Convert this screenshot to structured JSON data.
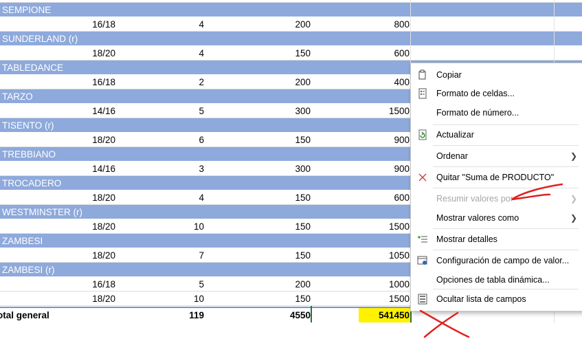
{
  "pivot": {
    "groups": [
      {
        "name": "SEMPIONE",
        "rows": [
          [
            "16/18",
            "4",
            "200",
            "800"
          ]
        ]
      },
      {
        "name": "SUNDERLAND (r)",
        "rows": [
          [
            "18/20",
            "4",
            "150",
            "600"
          ]
        ]
      },
      {
        "name": "TABLEDANCE",
        "rows": [
          [
            "16/18",
            "2",
            "200",
            "400"
          ]
        ]
      },
      {
        "name": "TARZO",
        "rows": [
          [
            "14/16",
            "5",
            "300",
            "1500"
          ]
        ]
      },
      {
        "name": "TISENTO (r)",
        "rows": [
          [
            "18/20",
            "6",
            "150",
            "900"
          ]
        ]
      },
      {
        "name": "TREBBIANO",
        "rows": [
          [
            "14/16",
            "3",
            "300",
            "900"
          ]
        ]
      },
      {
        "name": "TROCADERO",
        "rows": [
          [
            "18/20",
            "4",
            "150",
            "600"
          ]
        ]
      },
      {
        "name": "WESTMINSTER (r)",
        "rows": [
          [
            "18/20",
            "10",
            "150",
            "1500"
          ]
        ]
      },
      {
        "name": "ZAMBESI",
        "rows": [
          [
            "18/20",
            "7",
            "150",
            "1050"
          ]
        ]
      },
      {
        "name": "ZAMBESI (r)",
        "rows": [
          [
            "16/18",
            "5",
            "200",
            "1000"
          ],
          [
            "18/20",
            "10",
            "150",
            "1500"
          ]
        ]
      }
    ],
    "total": {
      "label": "otal general",
      "values": [
        "119",
        "4550",
        "541450"
      ]
    }
  },
  "context_menu": {
    "items": [
      {
        "label": "Copiar",
        "icon": "copy-icon",
        "enabled": true,
        "submenu": false
      },
      {
        "label": "Formato de celdas...",
        "icon": "format-cells-icon",
        "enabled": true,
        "submenu": false
      },
      {
        "label": "Formato de número...",
        "icon": "",
        "enabled": true,
        "submenu": false
      },
      {
        "label": "Actualizar",
        "icon": "refresh-icon",
        "enabled": true,
        "submenu": false
      },
      {
        "label": "Ordenar",
        "icon": "",
        "enabled": true,
        "submenu": true
      },
      {
        "label": "Quitar \"Suma de PRODUCTO\"",
        "icon": "remove-x-icon",
        "enabled": true,
        "submenu": false
      },
      {
        "label": "Resumir valores por",
        "icon": "",
        "enabled": false,
        "submenu": true
      },
      {
        "label": "Mostrar valores como",
        "icon": "",
        "enabled": true,
        "submenu": true
      },
      {
        "label": "Mostrar detalles",
        "icon": "show-details-icon",
        "enabled": true,
        "submenu": false
      },
      {
        "label": "Configuración de campo de valor...",
        "icon": "field-settings-icon",
        "enabled": true,
        "submenu": false
      },
      {
        "label": "Opciones de tabla dinámica...",
        "icon": "",
        "enabled": true,
        "submenu": false
      },
      {
        "label": "Ocultar lista de campos",
        "icon": "field-list-icon",
        "enabled": true,
        "submenu": false
      }
    ]
  },
  "colors": {
    "header_band": "#8ea9db",
    "highlight": "#fff200",
    "annotation": "#e02020",
    "remove_icon": "#d04040",
    "refresh_icon": "#3a9a3a"
  }
}
